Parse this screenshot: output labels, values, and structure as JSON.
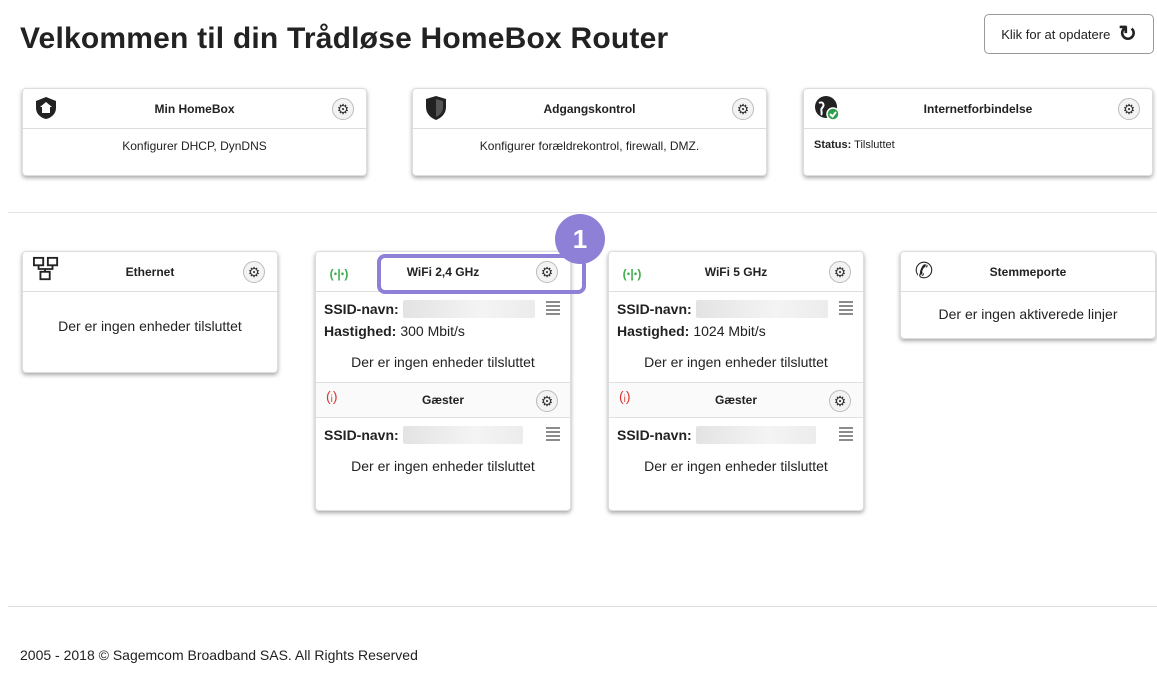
{
  "header": {
    "title": "Velkommen til din Trådløse HomeBox Router",
    "refresh_label": "Klik for at opdatere"
  },
  "top_cards": [
    {
      "title": "Min HomeBox",
      "body": "Konfigurer DHCP, DynDNS",
      "icon": "home-shield-icon"
    },
    {
      "title": "Adgangskontrol",
      "body": "Konfigurer forældrekontrol, firewall, DMZ.",
      "icon": "shield-icon"
    },
    {
      "title": "Internetforbindelse",
      "status_label": "Status:",
      "status_value": "Tilsluttet",
      "icon": "globe-check-icon"
    }
  ],
  "ethernet": {
    "title": "Ethernet",
    "message": "Der er ingen enheder tilsluttet",
    "icon": "network-icon"
  },
  "wifi24": {
    "title": "WiFi 2,4 GHz",
    "ssid_label": "SSID-navn:",
    "speed_label": "Hastighed:",
    "speed_value": "300 Mbit/s",
    "message": "Der er ingen enheder tilsluttet",
    "guest_title": "Gæster",
    "guest_ssid_label": "SSID-navn:",
    "guest_message": "Der er ingen enheder tilsluttet"
  },
  "wifi5": {
    "title": "WiFi 5 GHz",
    "ssid_label": "SSID-navn:",
    "speed_label": "Hastighed:",
    "speed_value": "1024 Mbit/s",
    "message": "Der er ingen enheder tilsluttet",
    "guest_title": "Gæster",
    "guest_ssid_label": "SSID-navn:",
    "guest_message": "Der er ingen enheder tilsluttet"
  },
  "voice": {
    "title": "Stemmeporte",
    "message": "Der er ingen aktiverede linjer",
    "icon": "phone-icon"
  },
  "annotation": {
    "badge": "1",
    "color": "#8f80d7"
  },
  "footer": {
    "text": "2005 - 2018 © Sagemcom Broadband SAS. All Rights Reserved"
  }
}
